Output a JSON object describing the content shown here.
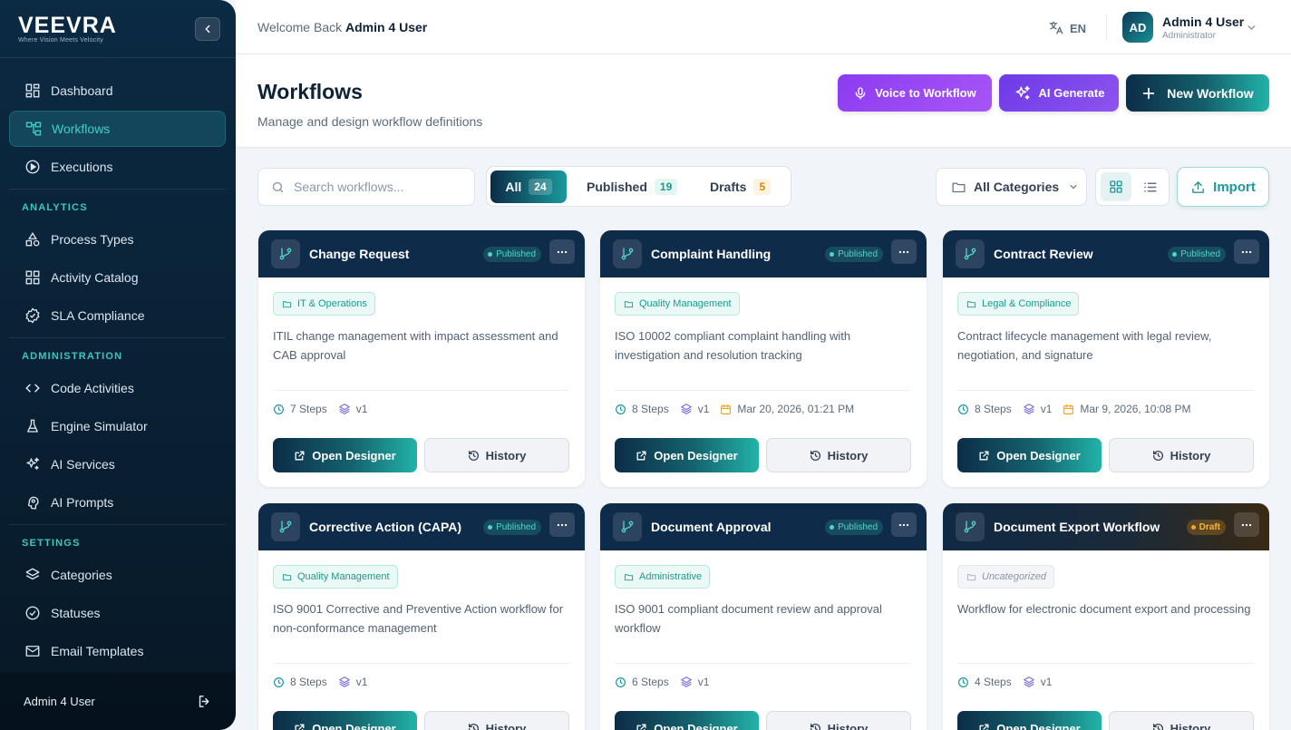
{
  "brand": {
    "name": "VEEVRA",
    "tagline": "Where Vision Meets Velocity"
  },
  "sidebar": {
    "items": [
      {
        "label": "Dashboard",
        "icon": "dashboard-icon"
      },
      {
        "label": "Workflows",
        "icon": "workflow-icon",
        "active": true
      },
      {
        "label": "Executions",
        "icon": "play-circle-icon"
      }
    ],
    "sections": [
      {
        "title": "ANALYTICS",
        "items": [
          {
            "label": "Process Types",
            "icon": "shapes-icon"
          },
          {
            "label": "Activity Catalog",
            "icon": "grid-icon"
          },
          {
            "label": "SLA Compliance",
            "icon": "badge-check-icon"
          }
        ]
      },
      {
        "title": "ADMINISTRATION",
        "items": [
          {
            "label": "Code Activities",
            "icon": "code-icon"
          },
          {
            "label": "Engine Simulator",
            "icon": "flask-icon"
          },
          {
            "label": "AI Services",
            "icon": "sparkles-icon"
          },
          {
            "label": "AI Prompts",
            "icon": "brain-icon"
          }
        ]
      },
      {
        "title": "SETTINGS",
        "items": [
          {
            "label": "Categories",
            "icon": "layers-icon"
          },
          {
            "label": "Statuses",
            "icon": "check-circle-icon"
          },
          {
            "label": "Email Templates",
            "icon": "mail-icon"
          }
        ]
      }
    ],
    "footer_user": "Admin 4 User"
  },
  "topbar": {
    "welcome_prefix": "Welcome Back",
    "welcome_user": "Admin 4 User",
    "language": "EN",
    "avatar_initials": "AD",
    "user_name": "Admin 4 User",
    "user_role": "Administrator"
  },
  "header": {
    "title": "Workflows",
    "subtitle": "Manage and design workflow definitions",
    "voice_button": "Voice to Workflow",
    "ai_button": "AI Generate",
    "new_button": "New Workflow"
  },
  "filters": {
    "search_placeholder": "Search workflows...",
    "tabs": [
      {
        "label": "All",
        "count": "24"
      },
      {
        "label": "Published",
        "count": "19"
      },
      {
        "label": "Drafts",
        "count": "5"
      }
    ],
    "category_select": "All Categories",
    "import_label": "Import"
  },
  "colors": {
    "accent": "#1a9a9e",
    "navy": "#0f2b4a",
    "voice": "#9333ea",
    "ai": "#7c3aed",
    "draft": "#f5a623"
  },
  "cards": [
    {
      "title": "Change Request",
      "status": "Published",
      "category": "IT & Operations",
      "description": "ITIL change management with impact assessment and CAB approval",
      "steps": "7 Steps",
      "version": "v1",
      "date": "",
      "open_label": "Open Designer",
      "history_label": "History"
    },
    {
      "title": "Complaint Handling",
      "status": "Published",
      "category": "Quality Management",
      "description": "ISO 10002 compliant complaint handling with investigation and resolution tracking",
      "steps": "8 Steps",
      "version": "v1",
      "date": "Mar 20, 2026, 01:21 PM",
      "open_label": "Open Designer",
      "history_label": "History"
    },
    {
      "title": "Contract Review",
      "status": "Published",
      "category": "Legal & Compliance",
      "description": "Contract lifecycle management with legal review, negotiation, and signature",
      "steps": "8 Steps",
      "version": "v1",
      "date": "Mar 9, 2026, 10:08 PM",
      "open_label": "Open Designer",
      "history_label": "History"
    },
    {
      "title": "Corrective Action (CAPA)",
      "status": "Published",
      "category": "Quality Management",
      "description": "ISO 9001 Corrective and Preventive Action workflow for non-conformance management",
      "steps": "8 Steps",
      "version": "v1",
      "date": "",
      "open_label": "Open Designer",
      "history_label": "History"
    },
    {
      "title": "Document Approval",
      "status": "Published",
      "category": "Administrative",
      "description": "ISO 9001 compliant document review and approval workflow",
      "steps": "6 Steps",
      "version": "v1",
      "date": "",
      "open_label": "Open Designer",
      "history_label": "History"
    },
    {
      "title": "Document Export Workflow",
      "status": "Draft",
      "category": "Uncategorized",
      "description": "Workflow for electronic document export and processing",
      "steps": "4 Steps",
      "version": "v1",
      "date": "",
      "open_label": "Open Designer",
      "history_label": "History"
    }
  ]
}
